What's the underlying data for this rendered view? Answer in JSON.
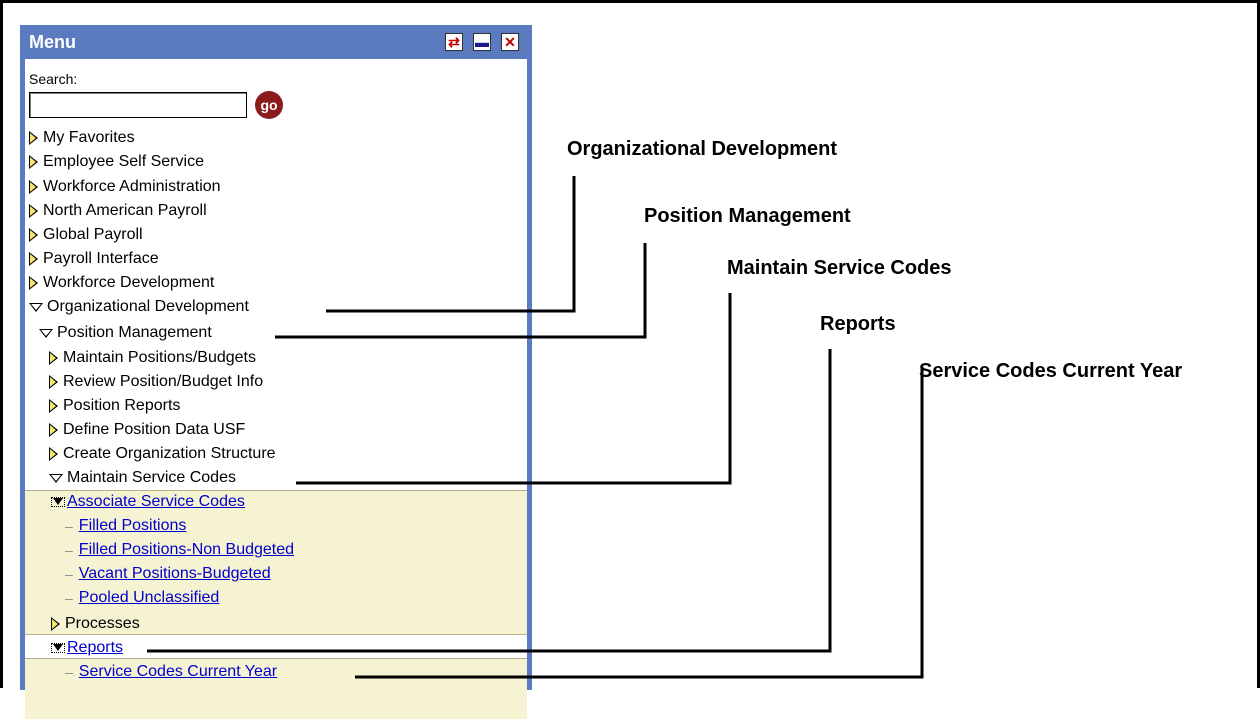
{
  "menu": {
    "title": "Menu",
    "search_label": "Search:",
    "search_value": "",
    "go_label": "go",
    "items": [
      {
        "label": "My Favorites",
        "state": "collapsed",
        "level": 0
      },
      {
        "label": "Employee Self Service",
        "state": "collapsed",
        "level": 0
      },
      {
        "label": "Workforce Administration",
        "state": "collapsed",
        "level": 0
      },
      {
        "label": "North American Payroll",
        "state": "collapsed",
        "level": 0
      },
      {
        "label": "Global Payroll",
        "state": "collapsed",
        "level": 0
      },
      {
        "label": "Payroll Interface",
        "state": "collapsed",
        "level": 0
      },
      {
        "label": "Workforce Development",
        "state": "collapsed",
        "level": 0
      },
      {
        "label": "Organizational Development",
        "state": "expanded",
        "level": 0
      },
      {
        "label": "Position Management",
        "state": "expanded",
        "level": 1
      },
      {
        "label": "Maintain Positions/Budgets",
        "state": "collapsed",
        "level": 2
      },
      {
        "label": "Review Position/Budget Info",
        "state": "collapsed",
        "level": 2
      },
      {
        "label": "Position Reports",
        "state": "collapsed",
        "level": 2
      },
      {
        "label": "Define Position Data USF",
        "state": "collapsed",
        "level": 2
      },
      {
        "label": "Create Organization Structure",
        "state": "collapsed",
        "level": 2
      },
      {
        "label": "Maintain Service Codes",
        "state": "expanded",
        "level": 2
      },
      {
        "label": "Associate Service Codes",
        "state": "expanded-link",
        "level": 3
      },
      {
        "label": "Filled Positions",
        "state": "link",
        "level": 4
      },
      {
        "label": "Filled Positions-Non Budgeted",
        "state": "link",
        "level": 4
      },
      {
        "label": "Vacant Positions-Budgeted",
        "state": "link",
        "level": 4
      },
      {
        "label": "Pooled Unclassified",
        "state": "link",
        "level": 4
      },
      {
        "label": "Processes",
        "state": "collapsed",
        "level": 3
      },
      {
        "label": "Reports",
        "state": "expanded-link",
        "level": 3
      },
      {
        "label": "Service Codes Current Year",
        "state": "link",
        "level": 4
      }
    ]
  },
  "callouts": {
    "org_dev": "Organizational Development",
    "pos_mgmt": "Position Management",
    "maint_codes": "Maintain Service Codes",
    "reports": "Reports",
    "codes_current": "Service Codes Current Year"
  },
  "colors": {
    "panel_blue": "#5a7bbf",
    "link_blue": "#0000cc",
    "band_yellow": "#f5f3d2"
  },
  "icons": {
    "refresh": "refresh-icon",
    "minimize": "minimize-icon",
    "close": "close-icon"
  }
}
